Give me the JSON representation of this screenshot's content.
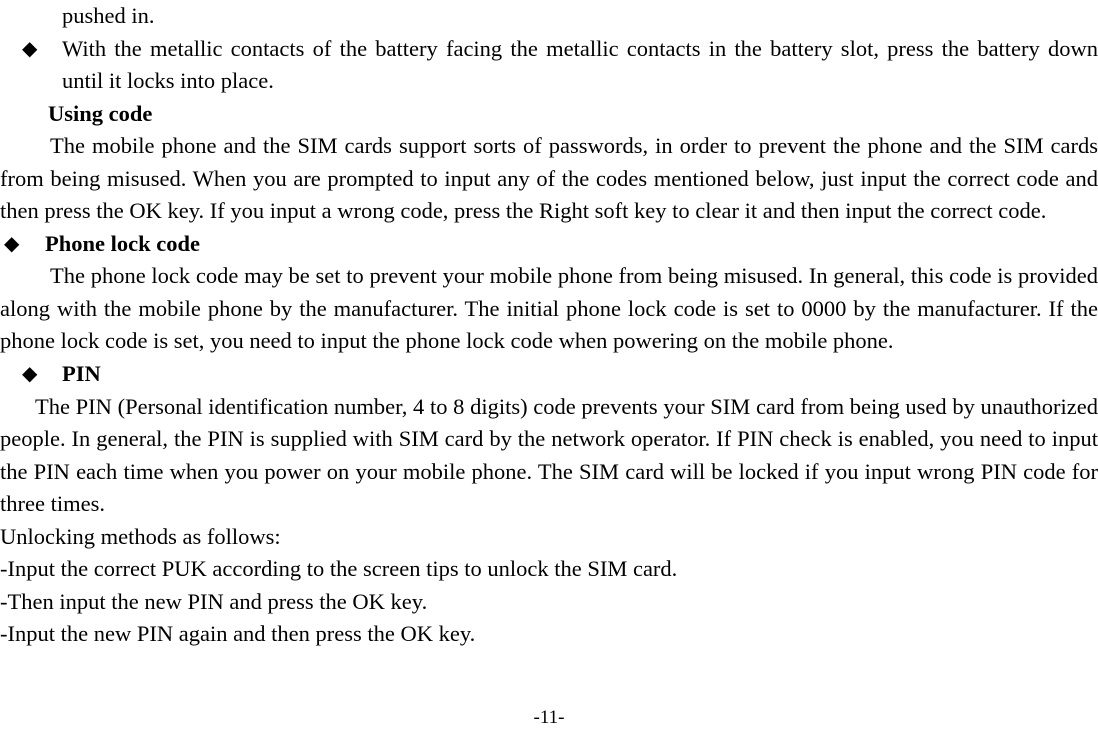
{
  "document": {
    "page_number_label": "-11-",
    "bullet_glyph": "◆"
  },
  "blocks": {
    "continuation_prev": "pushed in.",
    "battery_bullet": "With the metallic contacts of the battery facing the metallic contacts in the battery slot, press the battery down until it locks into place.",
    "using_code_heading": "Using code",
    "using_code_para": "The mobile phone and the SIM cards support sorts of passwords, in order to prevent the phone and the SIM cards from being misused. When you are prompted to input any of the codes mentioned below, just input the correct code and then press the OK key. If you input a wrong code, press the Right soft key to clear it and then input the correct code.",
    "phone_lock_heading": "Phone lock code",
    "phone_lock_para": "The phone lock code may be set to prevent your mobile phone from being misused. In general, this code is provided along with the mobile phone by the manufacturer. The initial phone lock code is set to 0000 by the manufacturer. If the phone lock code is set, you need to input the phone lock code when powering on the mobile phone.",
    "pin_heading": "PIN",
    "pin_para": "The PIN (Personal identification number, 4 to 8 digits) code prevents your SIM card from being used by unauthorized people. In general, the PIN is supplied with SIM card by the network operator. If PIN check is enabled, you need to input the PIN each time when you power on your mobile phone. The SIM card will be locked if you input wrong PIN code for three times.",
    "unlocking_intro": "Unlocking methods as follows:",
    "unlocking_steps": [
      "-Input the correct PUK according to the screen tips to unlock the SIM card.",
      "-Then input the new PIN and press the OK key.",
      "-Input the new PIN again and then press the OK key."
    ]
  },
  "colors": {
    "text": "#000000",
    "background": "#ffffff"
  }
}
